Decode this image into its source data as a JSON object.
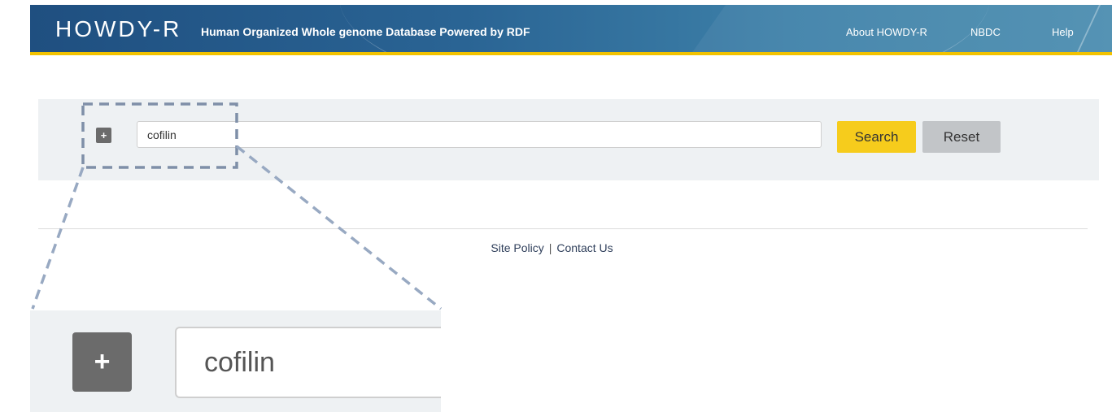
{
  "header": {
    "brand": "HOWDY-R",
    "tagline": "Human Organized Whole genome Database Powered by RDF",
    "nav": [
      "About HOWDY-R",
      "NBDC",
      "Help"
    ]
  },
  "search": {
    "expand_label": "+",
    "query": "cofilin",
    "search_label": "Search",
    "reset_label": "Reset"
  },
  "footer": {
    "site_policy": "Site Policy",
    "separator": "|",
    "contact_us": "Contact Us"
  },
  "zoom": {
    "expand_label": "+",
    "query": "cofilin"
  },
  "colors": {
    "header_blue": "#2a6494",
    "accent_yellow": "#f6cc1c",
    "reset_gray": "#c2c5c8",
    "callout_dash": "#7f8fa8"
  }
}
